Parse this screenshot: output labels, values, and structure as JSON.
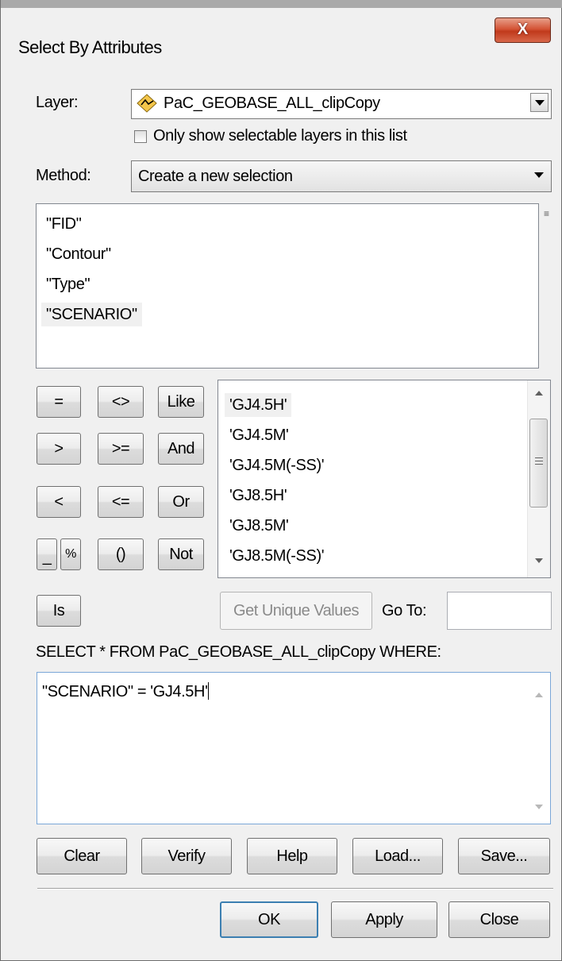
{
  "window": {
    "title": "Select By Attributes",
    "close_glyph": "X"
  },
  "layer": {
    "label": "Layer:",
    "value": "PaC_GEOBASE_ALL_clipCopy",
    "icon": "polyline-layer-icon",
    "only_selectable_label": "Only show selectable layers in this list",
    "only_selectable_checked": false
  },
  "method": {
    "label": "Method:",
    "value": "Create a new selection"
  },
  "fields": [
    "\"FID\"",
    "\"Contour\"",
    "\"Type\"",
    "\"SCENARIO\""
  ],
  "fields_selected_index": 3,
  "operators": {
    "eq": "=",
    "neq": "<>",
    "like": "Like",
    "gt": ">",
    "gte": ">=",
    "and": "And",
    "lt": "<",
    "lte": "<=",
    "or": "Or",
    "underscore": "_",
    "percent": "%",
    "parens": "()",
    "not": "Not",
    "is": "Is"
  },
  "unique_values": [
    "'GJ4.5H'",
    "'GJ4.5M'",
    "'GJ4.5M(-SS)'",
    "'GJ8.5H'",
    "'GJ8.5M'",
    "'GJ8.5M(-SS)'"
  ],
  "unique_values_selected_index": 0,
  "get_unique_values_label": "Get Unique Values",
  "goto_label": "Go To:",
  "goto_value": "",
  "sql_prefix": "SELECT * FROM PaC_GEOBASE_ALL_clipCopy WHERE:",
  "expression": "\"SCENARIO\" = 'GJ4.5H'",
  "actions": {
    "clear": "Clear",
    "verify": "Verify",
    "help": "Help",
    "load": "Load...",
    "save": "Save..."
  },
  "footer": {
    "ok": "OK",
    "apply": "Apply",
    "close": "Close"
  },
  "colors": {
    "close_button": "#c8452a",
    "selected_item_bg": "#f0f0f0",
    "window_bg": "#f0f0f0"
  }
}
